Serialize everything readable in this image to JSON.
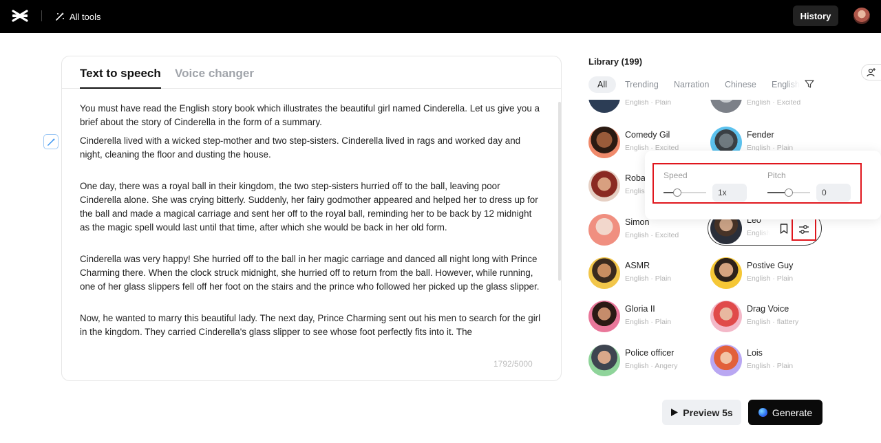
{
  "header": {
    "all_tools_label": "All tools",
    "history_label": "History"
  },
  "editor": {
    "tabs": [
      {
        "label": "Text to speech",
        "active": true
      },
      {
        "label": "Voice changer",
        "active": false
      }
    ],
    "paragraphs": [
      "You must have read the English story book which illustrates the beautiful girl named Cinderella. Let us give you a brief about the story of Cinderella in the form of a summary.",
      "Cinderella lived with a wicked step-mother and two step-sisters. Cinderella lived in rags and worked day and night, cleaning the floor and dusting the house.",
      "One day, there was a royal ball in their kingdom, the two step-sisters hurried off to the ball, leaving poor Cinderella alone. She was crying bitterly. Suddenly, her fairy godmother appeared and helped her to dress up for the ball and made a magical carriage and sent her off to the royal ball, reminding her to be back by 12 midnight as the magic spell would last until that time, after which she would be back in her old form.",
      "Cinderella was very happy! She hurried off to the ball in her magic carriage and danced all night long with Prince Charming there. When the clock struck midnight, she hurried off to return from the ball. However, while running, one of her glass slippers fell off her foot on the stairs and the prince who followed her picked up the glass slipper.",
      "Now, he wanted to marry this beautiful lady. The next day, Prince Charming sent out his men to search for the girl in the kingdom. They carried Cinderella's glass slipper to see whose foot perfectly fits into it. The"
    ],
    "char_count": "1792/5000"
  },
  "library": {
    "title": "Library (199)",
    "filters": [
      "All",
      "Trending",
      "Narration",
      "Chinese",
      "English"
    ],
    "voices": [
      {
        "name": "",
        "meta": "English · Plain"
      },
      {
        "name": "",
        "meta": "English · Excited"
      },
      {
        "name": "Comedy Gil",
        "meta": "English · Excited"
      },
      {
        "name": "Fender",
        "meta": "English · Plain"
      },
      {
        "name": "Roba",
        "meta": "English"
      },
      {
        "name": "Simon",
        "meta": "English · Excited"
      },
      {
        "name": "Leo",
        "meta": "English"
      },
      {
        "name": "ASMR",
        "meta": "English · Plain"
      },
      {
        "name": "Postive Guy",
        "meta": "English · Plain"
      },
      {
        "name": "Gloria II",
        "meta": "English · Plain"
      },
      {
        "name": "Drag Voice",
        "meta": "English · flattery"
      },
      {
        "name": "Police officer",
        "meta": "English · Angery"
      },
      {
        "name": "Lois",
        "meta": "English · Plain"
      }
    ]
  },
  "settings": {
    "speed_label": "Speed",
    "speed_value": "1x",
    "speed_fraction": 0.33,
    "pitch_label": "Pitch",
    "pitch_value": "0",
    "pitch_fraction": 0.5
  },
  "actions": {
    "preview_label": "Preview 5s",
    "generate_label": "Generate"
  },
  "colors": {
    "highlight": "#e0161d",
    "topbar": "#000000",
    "generate": "#0a0a0a"
  }
}
